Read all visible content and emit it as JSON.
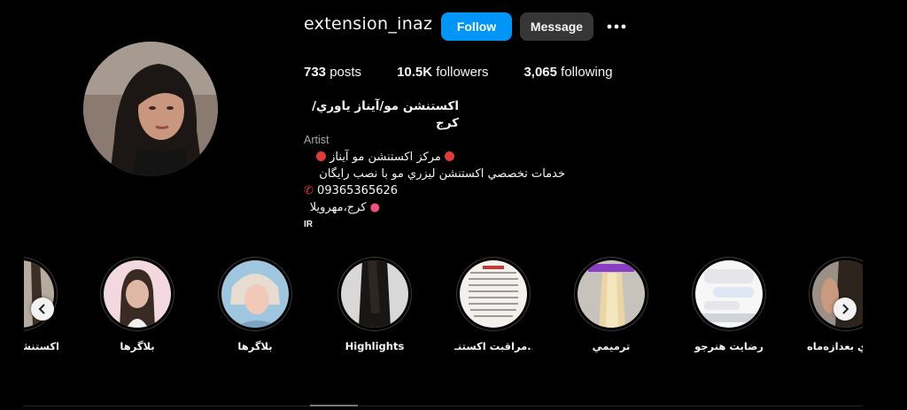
{
  "profile": {
    "username": "extension_inaz",
    "follow_label": "Follow",
    "message_label": "Message",
    "more_icon": "more-horizontal-icon"
  },
  "stats": {
    "posts_count": "733",
    "posts_label": "posts",
    "followers_count": "10.5K",
    "followers_label": "followers",
    "following_count": "3,065",
    "following_label": "following"
  },
  "bio": {
    "name": "اکستنشن مو/آیناز یاوري/کرج",
    "category": "Artist",
    "line1": "مرکز اکستنشن مو آیناز",
    "line2": "خدمات تخصصي اکستنشن ليزري مو با نصب رايگان",
    "phone": "09365365626",
    "location": "کرج،مهرويلا",
    "country": "IR"
  },
  "highlights": [
    {
      "label": "اکستنشن"
    },
    {
      "label": "بلاگرها"
    },
    {
      "label": "بلاگرها"
    },
    {
      "label": "Highlights"
    },
    {
      "label": "مراقبت اکستنـ..."
    },
    {
      "label": "ترميمي"
    },
    {
      "label": "رضايت هنرجو"
    },
    {
      "label": "ي بعدازه‌ماه"
    }
  ],
  "colors": {
    "accent": "#0095f6",
    "background": "#000000",
    "secondary_button": "#363636",
    "red_dot": "#e03b3b"
  }
}
